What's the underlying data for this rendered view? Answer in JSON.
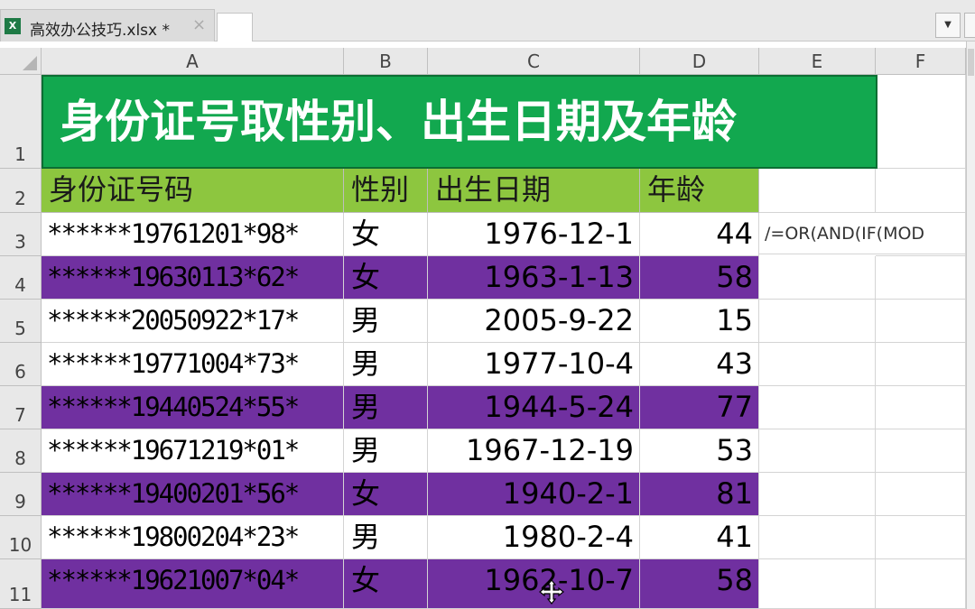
{
  "tab": {
    "icon": "X",
    "title": "高效办公技巧.xlsx *",
    "close": "×"
  },
  "tabmenu": {
    "arrow": "▼"
  },
  "columns": [
    "A",
    "B",
    "C",
    "D",
    "E",
    "F"
  ],
  "rows": [
    "1",
    "2",
    "3",
    "4",
    "5",
    "6",
    "7",
    "8",
    "9",
    "10",
    "11"
  ],
  "title": "身份证号取性别、出生日期及年龄",
  "headers": {
    "id": "身份证号码",
    "sex": "性别",
    "birth": "出生日期",
    "age": "年龄"
  },
  "formula_text": "/=OR(AND(IF(MOD",
  "colors": {
    "title_bg": "#12a84f",
    "header_bg": "#8dc63f",
    "highlight": "#7030a0"
  },
  "records": [
    {
      "id": "******19761201*98*",
      "sex": "女",
      "birth": "1976-12-1",
      "age": "44",
      "highlight": false
    },
    {
      "id": "******19630113*62*",
      "sex": "女",
      "birth": "1963-1-13",
      "age": "58",
      "highlight": true
    },
    {
      "id": "******20050922*17*",
      "sex": "男",
      "birth": "2005-9-22",
      "age": "15",
      "highlight": false
    },
    {
      "id": "******19771004*73*",
      "sex": "男",
      "birth": "1977-10-4",
      "age": "43",
      "highlight": false
    },
    {
      "id": "******19440524*55*",
      "sex": "男",
      "birth": "1944-5-24",
      "age": "77",
      "highlight": true
    },
    {
      "id": "******19671219*01*",
      "sex": "男",
      "birth": "1967-12-19",
      "age": "53",
      "highlight": false
    },
    {
      "id": "******19400201*56*",
      "sex": "女",
      "birth": "1940-2-1",
      "age": "81",
      "highlight": true
    },
    {
      "id": "******19800204*23*",
      "sex": "男",
      "birth": "1980-2-4",
      "age": "41",
      "highlight": false
    },
    {
      "id": "******19621007*04*",
      "sex": "女",
      "birth": "1962-10-7",
      "age": "58",
      "highlight": true
    }
  ]
}
